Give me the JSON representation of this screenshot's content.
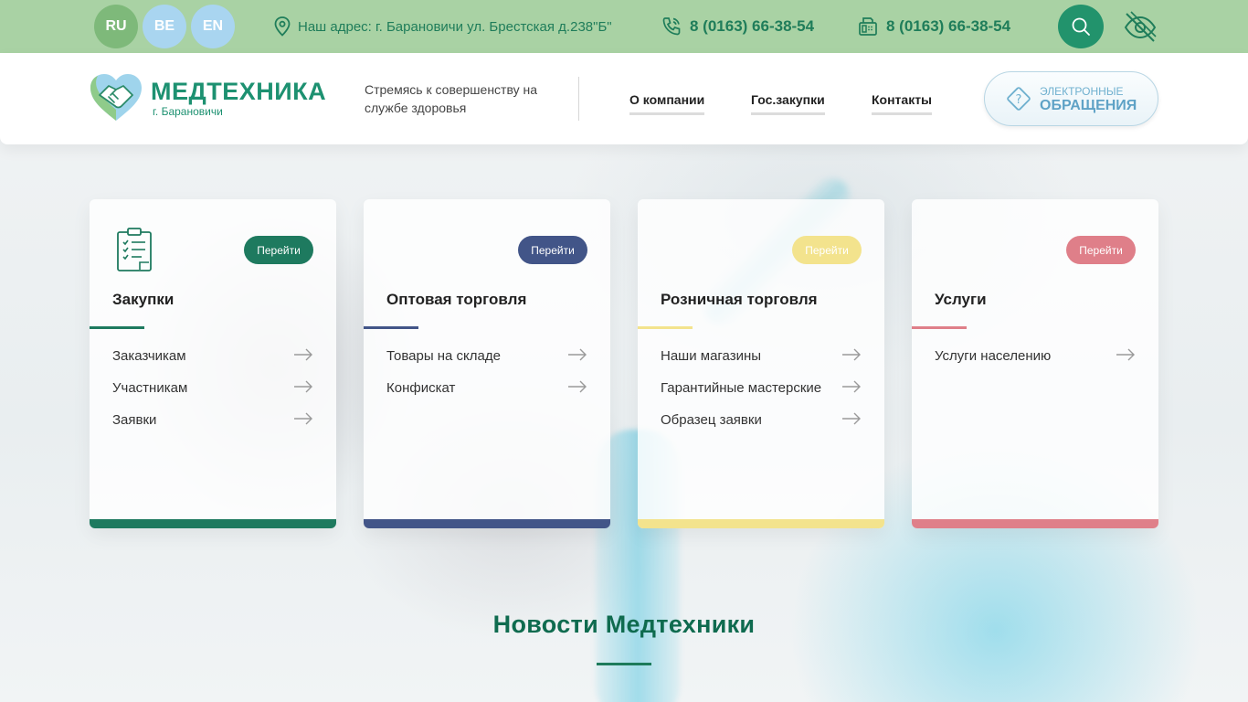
{
  "topbar": {
    "languages": [
      {
        "code": "RU"
      },
      {
        "code": "BE"
      },
      {
        "code": "EN"
      }
    ],
    "address": "Наш адрес: г. Барановичи ул. Брестская д.238\"Б\"",
    "phone1": "8 (0163) 66-38-54",
    "phone2": "8 (0163) 66-38-54",
    "icons": {
      "address": "location-pin-icon",
      "phone": "phone-icon",
      "fax": "fax-icon",
      "search": "search-icon",
      "accessibility": "eye-off-icon"
    }
  },
  "header": {
    "logo_name": "МЕДТЕХНИКА",
    "logo_city": "г. Барановичи",
    "slogan": "Стремясь к совершенству на службе здоровья",
    "nav": [
      {
        "label": "О компании"
      },
      {
        "label": "Гос.закупки"
      },
      {
        "label": "Контакты"
      }
    ],
    "appeal": {
      "line1": "ЭЛЕКТРОННЫЕ",
      "line2": "ОБРАЩЕНИЯ"
    }
  },
  "colors": {
    "topbar": "#a9d2a4",
    "brand_green": "#1d9171",
    "card1": "#1e7a5f",
    "card2": "#425588",
    "card3": "#f3e38d",
    "card4": "#df7f89"
  },
  "cards": [
    {
      "title": "Закупки",
      "go_label": "Перейти",
      "links": [
        "Заказчикам",
        "Участникам",
        "Заявки"
      ]
    },
    {
      "title": "Оптовая торговля",
      "go_label": "Перейти",
      "links": [
        "Товары на складе",
        "Конфискат"
      ]
    },
    {
      "title": "Розничная торговля",
      "go_label": "Перейти",
      "links": [
        "Наши магазины",
        "Гарантийные мастерские",
        "Образец заявки"
      ]
    },
    {
      "title": "Услуги",
      "go_label": "Перейти",
      "links": [
        "Услуги населению"
      ]
    }
  ],
  "news": {
    "title": "Новости Медтехники"
  }
}
